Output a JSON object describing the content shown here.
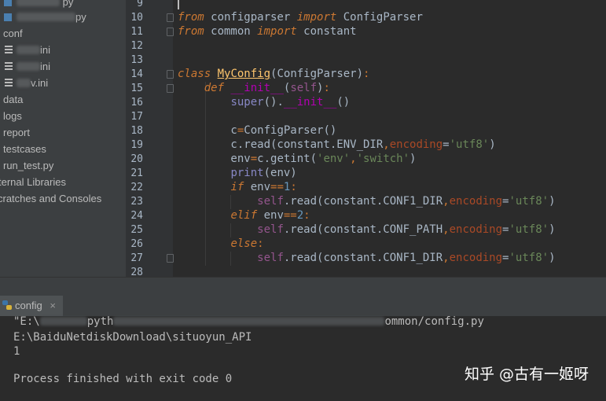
{
  "project_tree": {
    "items": [
      {
        "text": "py",
        "partial": true
      },
      {
        "text": "py",
        "partial": true
      },
      {
        "text": "conf"
      },
      {
        "text": "ini",
        "partial": true
      },
      {
        "text": "ini",
        "partial": true
      },
      {
        "text": "v.ini",
        "partial": true
      },
      {
        "text": "data"
      },
      {
        "text": "logs"
      },
      {
        "text": "report"
      },
      {
        "text": "testcases"
      },
      {
        "text": "run_test.py"
      },
      {
        "text": "ternal Libraries"
      },
      {
        "text": "cratches and Consoles"
      }
    ]
  },
  "editor": {
    "line_numbers": [
      "9",
      "10",
      "11",
      "12",
      "13",
      "14",
      "15",
      "16",
      "17",
      "18",
      "19",
      "20",
      "21",
      "22",
      "23",
      "24",
      "25",
      "26",
      "27",
      "28"
    ]
  },
  "run_panel": {
    "tab_label": "config",
    "lines": {
      "cmd_start": "\"E:\\",
      "cmd_mid": "pyth",
      "cmd_end": "ommon/config.py",
      "cwd": "E:\\BaiduNetdiskDownload\\situoyun_API",
      "output": "1",
      "exit": "Process finished with exit code 0"
    }
  },
  "watermark": "知乎 @古有一姬呀",
  "colors": {
    "keyword": "#cc7832",
    "string": "#6a8759",
    "self": "#94558d",
    "kwarg": "#aa4926",
    "function": "#ffc66d",
    "background": "#2b2b2b",
    "sidebar": "#3c3f41"
  }
}
